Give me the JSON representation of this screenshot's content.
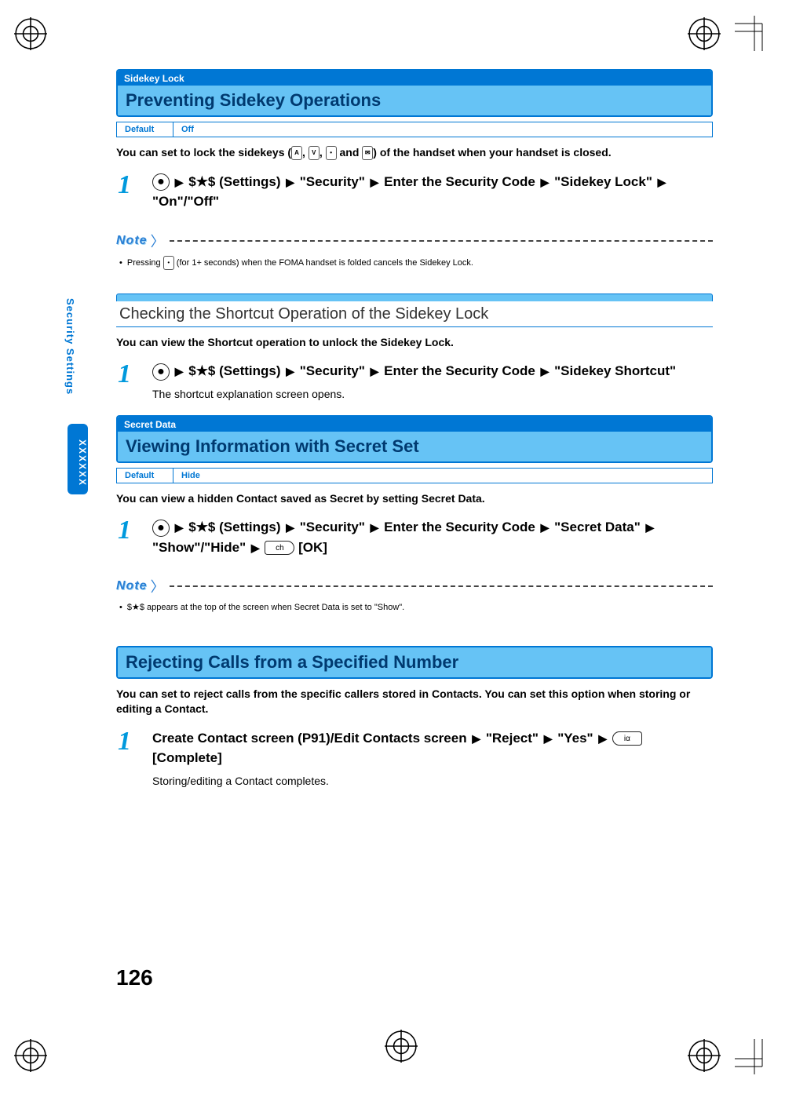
{
  "sideTab": {
    "label": "Security Settings",
    "pageMarker": "XXXXXX"
  },
  "pageNumber": "126",
  "section1": {
    "tag": "Sidekey Lock",
    "title": "Preventing Sidekey Operations",
    "defaultLabel": "Default",
    "defaultValue": "Off",
    "lead": "You can set to lock the sidekeys (",
    "leadTail": ") of the handset when your handset is closed.",
    "keySep": ", ",
    "keyAnd": " and ",
    "step1": {
      "num": "1",
      "txt_a": " $★$ (Settings) ",
      "txt_b": " \"Security\" ",
      "txt_c": " Enter the Security Code ",
      "txt_d": " \"Sidekey Lock\" ",
      "txt_e": " \"On\"/\"Off\""
    },
    "noteLabel": "Note",
    "noteText": "Pressing ",
    "noteTextTail": " (for 1+ seconds) when the FOMA handset is folded cancels the Sidekey Lock."
  },
  "subsection1": {
    "title": "Checking the Shortcut Operation of the Sidekey Lock",
    "lead": "You can view the Shortcut operation to unlock the Sidekey Lock.",
    "step1": {
      "num": "1",
      "txt_a": " $★$ (Settings) ",
      "txt_b": " \"Security\" ",
      "txt_c": " Enter the Security Code ",
      "txt_d": " \"Sidekey Shortcut\"",
      "explain": "The shortcut explanation screen opens."
    }
  },
  "section2": {
    "tag": "Secret Data",
    "title": "Viewing Information with Secret Set",
    "defaultLabel": "Default",
    "defaultValue": "Hide",
    "lead": "You can view a hidden Contact saved as Secret by setting Secret Data.",
    "step1": {
      "num": "1",
      "txt_a": " $★$ (Settings) ",
      "txt_b": " \"Security\" ",
      "txt_c": " Enter the Security Code ",
      "txt_d": " \"Secret Data\" ",
      "txt_e": " \"Show\"/\"Hide\" ",
      "txt_f": " [OK]"
    },
    "noteLabel": "Note",
    "noteText": "$★$ appears at the top of the screen when Secret Data is set to \"Show\"."
  },
  "section3": {
    "title": "Rejecting Calls from a Specified Number",
    "lead": "You can set to reject calls from the specific callers stored in Contacts. You can set this option when storing or editing a Contact.",
    "step1": {
      "num": "1",
      "txt_a": "Create Contact screen (P91)/Edit Contacts screen ",
      "txt_b": " \"Reject\" ",
      "txt_c": " \"Yes\" ",
      "txt_d": " [Complete]",
      "explain": "Storing/editing a Contact completes."
    }
  },
  "keys": {
    "centerDot": "●",
    "sideA": "A",
    "sideV": "V",
    "sideDot": "•",
    "sideMail": "✉",
    "softOK": "ch",
    "softComplete": "iα"
  }
}
